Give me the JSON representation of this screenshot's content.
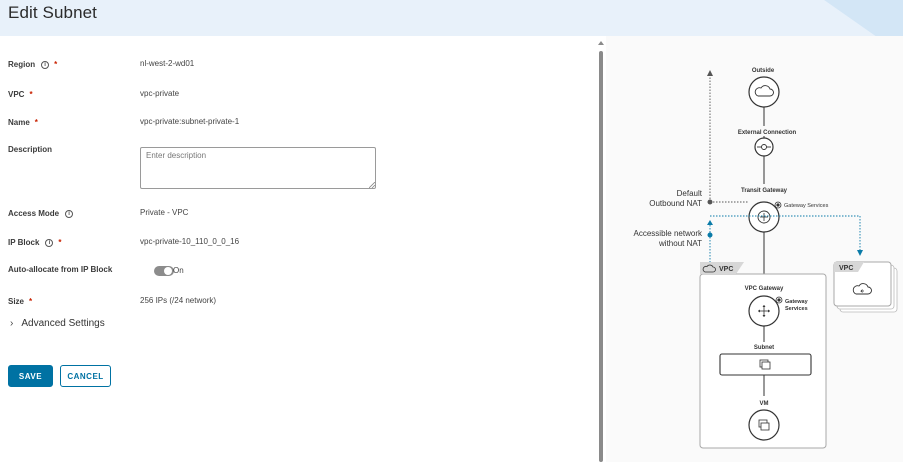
{
  "header": {
    "title": "Edit Subnet"
  },
  "form": {
    "region": {
      "label": "Region",
      "value": "nl-west-2-wd01"
    },
    "vpc": {
      "label": "VPC",
      "value": "vpc-private"
    },
    "name": {
      "label": "Name",
      "value": "vpc-private:subnet-private-1"
    },
    "description": {
      "label": "Description",
      "value": "",
      "placeholder": "Enter description"
    },
    "access_mode": {
      "label": "Access Mode",
      "value": "Private - VPC"
    },
    "ip_block": {
      "label": "IP Block",
      "value": "vpc-private-10_110_0_0_16"
    },
    "auto_allocate": {
      "label": "Auto-allocate from IP Block",
      "toggle_label": "On"
    },
    "size": {
      "label": "Size",
      "value": "256 IPs (/24 network)"
    },
    "required_mark": "*",
    "info_glyph": "i"
  },
  "advanced": {
    "label": "Advanced Settings"
  },
  "buttons": {
    "save": "SAVE",
    "cancel": "CANCEL"
  },
  "diagram": {
    "outside": "Outside",
    "external_connection": "External Connection",
    "transit_gateway": "Transit Gateway",
    "gateway_services_1": "Gateway Services",
    "default_nat_1": "Default",
    "default_nat_2": "Outbound NAT",
    "accessible_1": "Accessible network",
    "accessible_2": "without NAT",
    "vpc_tab": "VPC",
    "vpc_gateway": "VPC Gateway",
    "gateway_services_2a": "Gateway",
    "gateway_services_2b": "Services",
    "subnet": "Subnet",
    "vm": "VM",
    "vpc_other": "VPC"
  },
  "colors": {
    "primary": "#0072a3",
    "required": "#c92100",
    "accent_teal": "#0a7ba8"
  }
}
